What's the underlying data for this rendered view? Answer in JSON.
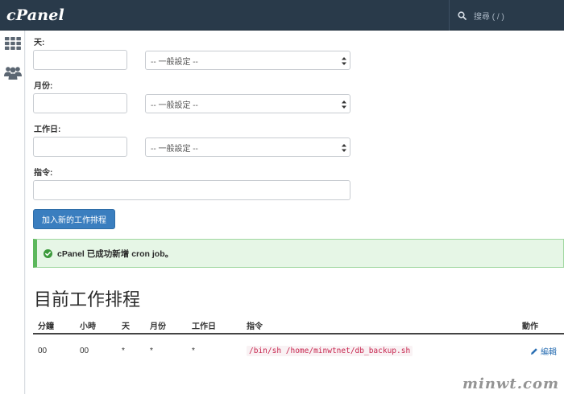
{
  "header": {
    "logo": "cPanel",
    "search_placeholder": "搜尋 ( / )"
  },
  "sidebar": {
    "items": [
      {
        "icon": "grid-icon"
      },
      {
        "icon": "users-icon"
      }
    ]
  },
  "form": {
    "day_label": "天:",
    "month_label": "月份:",
    "weekday_label": "工作日:",
    "command_label": "指令:",
    "day_select": "-- 一般設定 --",
    "month_select": "-- 一般設定 --",
    "weekday_select": "-- 一般設定 --",
    "add_button": "加入新的工作排程"
  },
  "alert": {
    "message": "cPanel 已成功新增 cron job。"
  },
  "jobs": {
    "title": "目前工作排程",
    "columns": [
      "分鐘",
      "小時",
      "天",
      "月份",
      "工作日",
      "指令",
      "動作"
    ],
    "rows": [
      {
        "minute": "00",
        "hour": "00",
        "day": "*",
        "month": "*",
        "weekday": "*",
        "command": "/bin/sh /home/minwtnet/db_backup.sh",
        "action": "編輯"
      }
    ]
  },
  "watermark": "minwt.com",
  "colors": {
    "header_bg": "#293a4a",
    "primary_button": "#3a7ebf",
    "success_bg": "#e6f6e6",
    "success_border": "#5cb85c",
    "command_text": "#c7254e"
  }
}
